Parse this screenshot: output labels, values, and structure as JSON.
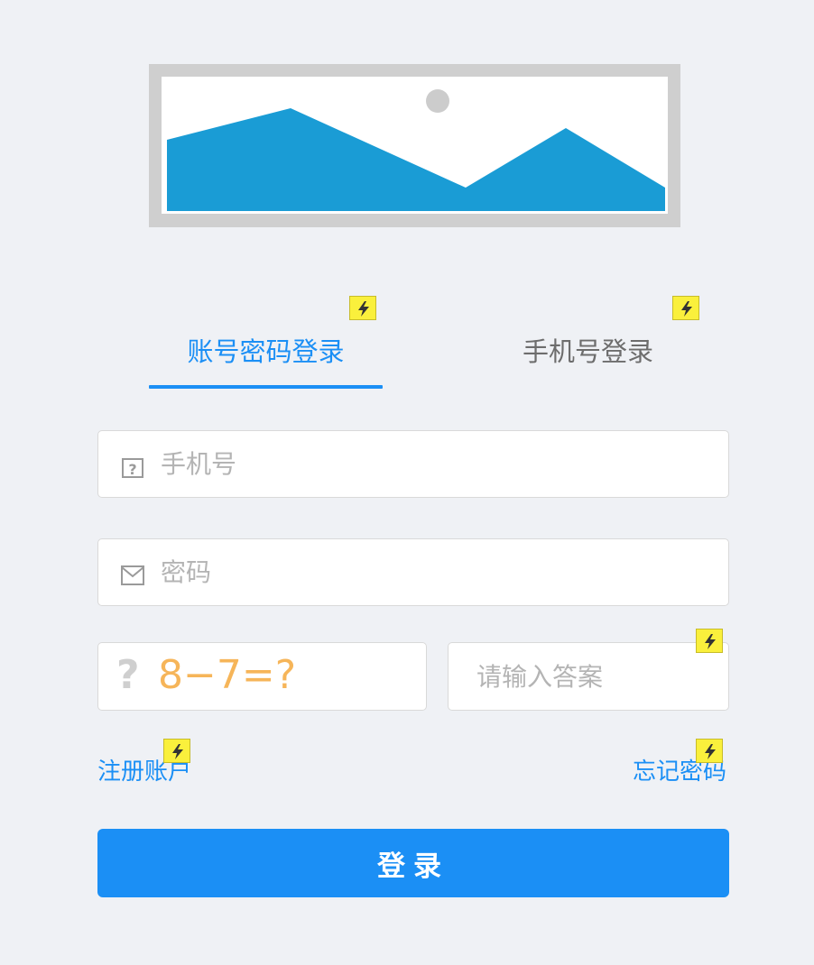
{
  "tabs": {
    "account_label": "账号密码登录",
    "phone_label": "手机号登录"
  },
  "form": {
    "phone_placeholder": "手机号",
    "password_placeholder": "密码",
    "captcha_expression": "8−7=?",
    "answer_placeholder": "请输入答案"
  },
  "links": {
    "register": "注册账户",
    "forgot": "忘记密码"
  },
  "login_button": "登录",
  "icons": {
    "logo": "image-placeholder-icon",
    "phone": "question-box-icon",
    "password": "mail-icon",
    "captcha": "question-mark-icon",
    "flash": "lightning-icon"
  },
  "colors": {
    "accent": "#1b8ff5",
    "captcha": "#f6b559",
    "background": "#eff1f5",
    "placeholder_image_fill": "#1a9cd5",
    "flash_marker": "#faf03c"
  }
}
